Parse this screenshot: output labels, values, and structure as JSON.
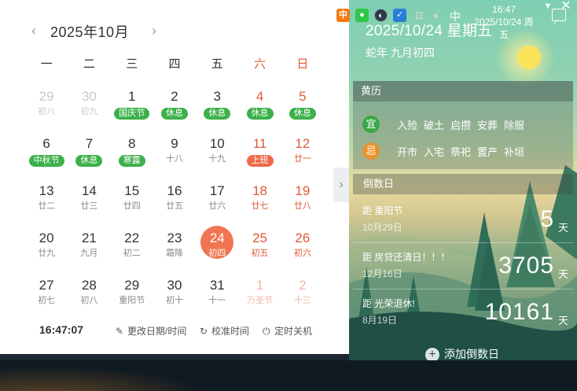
{
  "calendar": {
    "month_title": "2025年10月",
    "prev_icon": "chevron-left",
    "next_icon": "chevron-right",
    "weekdays": [
      "一",
      "二",
      "三",
      "四",
      "五",
      "六",
      "日"
    ],
    "days": [
      {
        "n": "29",
        "s": "初八",
        "faded": true
      },
      {
        "n": "30",
        "s": "初九",
        "faded": true
      },
      {
        "n": "1",
        "s": "国庆节",
        "pill": "green"
      },
      {
        "n": "2",
        "s": "休息",
        "pill": "green"
      },
      {
        "n": "3",
        "s": "休息",
        "pill": "green"
      },
      {
        "n": "4",
        "s": "休息",
        "pill": "green",
        "we": true
      },
      {
        "n": "5",
        "s": "休息",
        "pill": "green",
        "we": true
      },
      {
        "n": "6",
        "s": "中秋节",
        "pill": "green"
      },
      {
        "n": "7",
        "s": "休息",
        "pill": "green"
      },
      {
        "n": "8",
        "s": "寒露",
        "pill": "green"
      },
      {
        "n": "9",
        "s": "十八"
      },
      {
        "n": "10",
        "s": "十九"
      },
      {
        "n": "11",
        "s": "上班",
        "pill": "red",
        "we": true
      },
      {
        "n": "12",
        "s": "廿一",
        "we": true
      },
      {
        "n": "13",
        "s": "廿二"
      },
      {
        "n": "14",
        "s": "廿三"
      },
      {
        "n": "15",
        "s": "廿四"
      },
      {
        "n": "16",
        "s": "廿五"
      },
      {
        "n": "17",
        "s": "廿六"
      },
      {
        "n": "18",
        "s": "廿七",
        "we": true
      },
      {
        "n": "19",
        "s": "廿八",
        "we": true
      },
      {
        "n": "20",
        "s": "廿九"
      },
      {
        "n": "21",
        "s": "九月"
      },
      {
        "n": "22",
        "s": "初二"
      },
      {
        "n": "23",
        "s": "霜降"
      },
      {
        "n": "24",
        "s": "初四",
        "today": true
      },
      {
        "n": "25",
        "s": "初五",
        "we": true
      },
      {
        "n": "26",
        "s": "初六",
        "we": true
      },
      {
        "n": "27",
        "s": "初七"
      },
      {
        "n": "28",
        "s": "初八"
      },
      {
        "n": "29",
        "s": "重阳节"
      },
      {
        "n": "30",
        "s": "初十"
      },
      {
        "n": "31",
        "s": "十一"
      },
      {
        "n": "1",
        "s": "万圣节",
        "faded": true,
        "we": true
      },
      {
        "n": "2",
        "s": "十三",
        "faded": true,
        "we": true
      }
    ],
    "clock": "16:47:07",
    "footer": {
      "change_label": "更改日期/时间",
      "sync_label": "校准时间",
      "shutdown_label": "定时关机"
    }
  },
  "panel": {
    "date": "2025/10/24  星期五",
    "lunar": "蛇年 九月初四",
    "huangli": {
      "title": "黄历",
      "yi_badge": "宜",
      "yi_items": [
        "入殓",
        "破土",
        "启攒",
        "安葬",
        "除服"
      ],
      "ji_badge": "忌",
      "ji_items": [
        "开市",
        "入宅",
        "祭祀",
        "置产",
        "补垣"
      ]
    },
    "countdown": {
      "title": "倒数日",
      "items": [
        {
          "name": "距 重阳节",
          "date": "10月29日",
          "days": "5",
          "unit": "天"
        },
        {
          "name": "距 房贷还清日！！！",
          "date": "12月16日",
          "days": "3705",
          "unit": "天"
        },
        {
          "name": "距 光荣退休!",
          "date": "8月19日",
          "days": "10161",
          "unit": "天"
        }
      ],
      "add_label": "添加倒数日"
    }
  },
  "taskbar": {
    "ime_icon_text": "中",
    "lang": "中",
    "time": "16:47",
    "date": "2025/10/24 周五"
  },
  "colors": {
    "accent_today": "#f07552",
    "holiday_green": "#3cb04a",
    "workday_red": "#ef6a4a",
    "weekend_text": "#e05a36"
  }
}
